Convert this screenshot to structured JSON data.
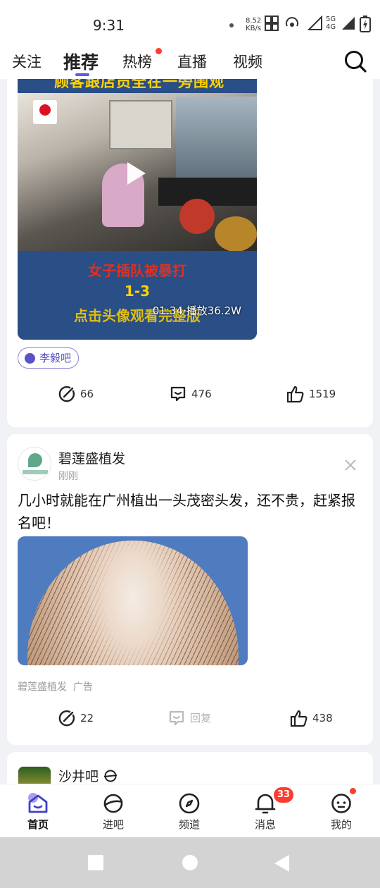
{
  "status_bar": {
    "time": "9:31",
    "net_speed": "8.52",
    "net_unit": "KB/s",
    "network_type_top": "5G",
    "network_type_bottom": "4G"
  },
  "top_tabs": [
    {
      "label": "关注",
      "active": false
    },
    {
      "label": "推荐",
      "active": true
    },
    {
      "label": "热榜",
      "active": false,
      "dot": true
    },
    {
      "label": "直播",
      "active": false
    },
    {
      "label": "视频",
      "active": false
    }
  ],
  "video_post": {
    "banner_text": "顾客跟店员全在一旁围观",
    "caption_line1": "女子插队被暴打",
    "caption_line2": "1-3",
    "caption_line3": "点击头像观看完整版",
    "duration": "01:34",
    "play_count": "播放36.2W",
    "meta_separator": "·",
    "forum_chip": "李毅吧",
    "shares": "66",
    "comments": "476",
    "likes": "1519"
  },
  "ad_post": {
    "author": "碧莲盛植发",
    "time": "刚刚",
    "title": "几小时就能在广州植出一头茂密头发，还不贵，赶紧报名吧！",
    "footer": "碧莲盛植发  广告",
    "shares": "22",
    "comments": "回复",
    "likes": "438"
  },
  "next_post": {
    "author": "沙井吧"
  },
  "bottom_nav": [
    {
      "label": "首页",
      "icon": "home-icon",
      "active": true
    },
    {
      "label": "进吧",
      "icon": "planet-icon",
      "active": false
    },
    {
      "label": "频道",
      "icon": "compass-icon",
      "active": false
    },
    {
      "label": "消息",
      "icon": "bell-icon",
      "active": false,
      "badge": "33"
    },
    {
      "label": "我的",
      "icon": "face-icon",
      "active": false,
      "dot": true
    }
  ],
  "colors": {
    "accent": "#5b5be6",
    "badge": "#ff3b30",
    "background": "#f1f2f5"
  }
}
